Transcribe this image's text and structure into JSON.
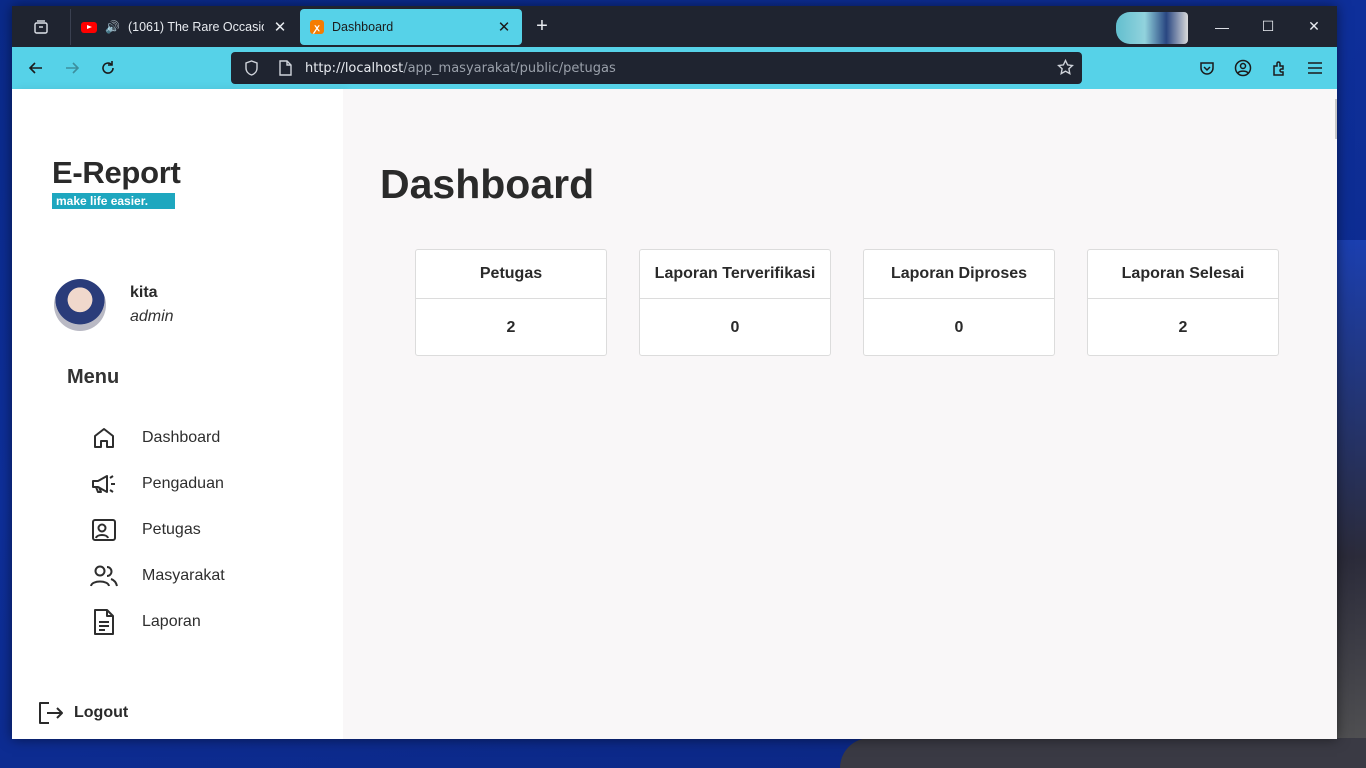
{
  "browser": {
    "tabs": [
      {
        "title": "(1061) The Rare Occasions |",
        "icon": "youtube-icon",
        "audio": true
      },
      {
        "title": "Dashboard",
        "icon": "xampp-icon",
        "active": true
      }
    ],
    "url_host": "http://localhost",
    "url_path": "/app_masyarakat/public/petugas",
    "accent": "#56d2e8"
  },
  "sidebar": {
    "brand": "E-Report",
    "tagline": "make life easier.",
    "user": {
      "name": "kita",
      "role": "admin"
    },
    "menu_title": "Menu",
    "items": [
      {
        "label": "Dashboard",
        "icon": "home-icon"
      },
      {
        "label": "Pengaduan",
        "icon": "megaphone-icon"
      },
      {
        "label": "Petugas",
        "icon": "id-card-icon"
      },
      {
        "label": "Masyarakat",
        "icon": "users-icon"
      },
      {
        "label": "Laporan",
        "icon": "document-icon"
      }
    ],
    "logout": "Logout"
  },
  "main": {
    "title": "Dashboard",
    "cards": [
      {
        "label": "Petugas",
        "value": "2"
      },
      {
        "label": "Laporan Terverifikasi",
        "value": "0"
      },
      {
        "label": "Laporan Diproses",
        "value": "0"
      },
      {
        "label": "Laporan Selesai",
        "value": "2"
      }
    ]
  }
}
